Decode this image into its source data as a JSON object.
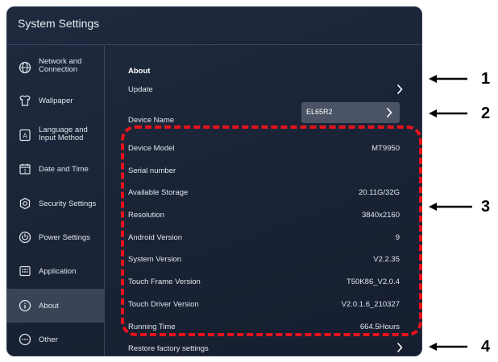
{
  "window": {
    "title": "System Settings"
  },
  "sidebar": {
    "items": [
      {
        "label_1": "Network and",
        "label_2": "Connection",
        "icon": "globe-icon"
      },
      {
        "label": "Wallpaper",
        "icon": "shirt-icon"
      },
      {
        "label_1": "Language and",
        "label_2": "Input Method",
        "icon": "language-icon",
        "icon_text": "A"
      },
      {
        "label": "Date and Time",
        "icon": "calendar-icon",
        "icon_text": "1"
      },
      {
        "label": "Security Settings",
        "icon": "shield-icon"
      },
      {
        "label": "Power Settings",
        "icon": "power-icon"
      },
      {
        "label": "Application",
        "icon": "apps-icon"
      },
      {
        "label": "About",
        "icon": "info-icon",
        "active": true
      },
      {
        "label": "Other",
        "icon": "more-icon"
      }
    ]
  },
  "about": {
    "section_title": "About",
    "update_label": "Update",
    "device_name_label": "Device Name",
    "device_name_value": "EL65R2",
    "info_rows": [
      {
        "label": "Device Model",
        "value": "MT9950"
      },
      {
        "label": "Serial number",
        "value": ""
      },
      {
        "label": "Available Storage",
        "value": "20.11G/32G"
      },
      {
        "label": "Resolution",
        "value": "3840x2160"
      },
      {
        "label": "Android Version",
        "value": "9"
      },
      {
        "label": "System Version",
        "value": "V2.2.35"
      },
      {
        "label": "Touch Frame Version",
        "value": "T50K86_V2.0.4"
      },
      {
        "label": "Touch Driver Version",
        "value": "V2.0.1.6_210327"
      },
      {
        "label": "Running Time",
        "value": "664.5Hours"
      }
    ],
    "restore_label": "Restore factory settings"
  },
  "callouts": [
    "1",
    "2",
    "3",
    "4"
  ],
  "colors": {
    "panel_bg": "#1c2638",
    "active_item": "#3a4457",
    "highlight_dashed": "#e8121c",
    "device_box": "#4a5466"
  }
}
